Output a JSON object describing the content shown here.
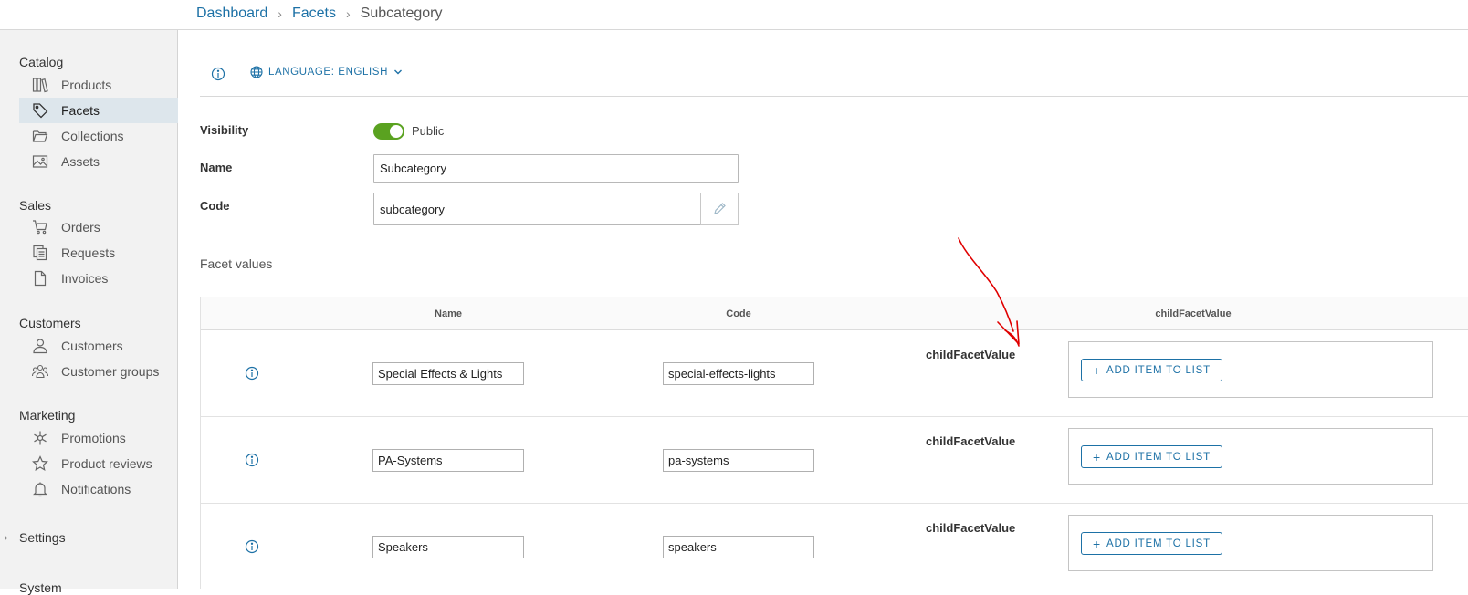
{
  "breadcrumb": {
    "items": [
      "Dashboard",
      "Facets",
      "Subcategory"
    ],
    "separator": "›"
  },
  "sidebar": {
    "sections": [
      {
        "title": "Catalog",
        "items": [
          {
            "label": "Products",
            "icon": "books-icon"
          },
          {
            "label": "Facets",
            "icon": "tag-icon",
            "active": true
          },
          {
            "label": "Collections",
            "icon": "folder-open-icon"
          },
          {
            "label": "Assets",
            "icon": "image-icon"
          }
        ]
      },
      {
        "title": "Sales",
        "items": [
          {
            "label": "Orders",
            "icon": "cart-icon"
          },
          {
            "label": "Requests",
            "icon": "copy-icon"
          },
          {
            "label": "Invoices",
            "icon": "file-icon"
          }
        ]
      },
      {
        "title": "Customers",
        "items": [
          {
            "label": "Customers",
            "icon": "user-icon"
          },
          {
            "label": "Customer groups",
            "icon": "users-icon"
          }
        ]
      },
      {
        "title": "Marketing",
        "items": [
          {
            "label": "Promotions",
            "icon": "asterisk-icon"
          },
          {
            "label": "Product reviews",
            "icon": "star-icon"
          },
          {
            "label": "Notifications",
            "icon": "bell-icon"
          }
        ]
      }
    ],
    "settings_label": "Settings",
    "system_label": "System"
  },
  "toolbar": {
    "language_label": "LANGUAGE: ENGLISH"
  },
  "form": {
    "visibility_label": "Visibility",
    "visibility_value": "Public",
    "visibility_on": true,
    "name_label": "Name",
    "name_value": "Subcategory",
    "code_label": "Code",
    "code_value": "subcategory"
  },
  "facet_values": {
    "title": "Facet values",
    "columns": [
      "Name",
      "Code",
      "childFacetValue"
    ],
    "rows": [
      {
        "name": "Special Effects & Lights",
        "code": "special-effects-lights",
        "field_label": "childFacetValue",
        "button_label": "ADD ITEM TO LIST"
      },
      {
        "name": "PA-Systems",
        "code": "pa-systems",
        "field_label": "childFacetValue",
        "button_label": "ADD ITEM TO LIST"
      },
      {
        "name": "Speakers",
        "code": "speakers",
        "field_label": "childFacetValue",
        "button_label": "ADD ITEM TO LIST"
      }
    ]
  },
  "colors": {
    "accent": "#1d71a6",
    "toggle_on": "#5aa220",
    "annotation": "#e00000",
    "sidebar_bg": "#f2f2f2",
    "active_item_bg": "#dde6ec"
  }
}
